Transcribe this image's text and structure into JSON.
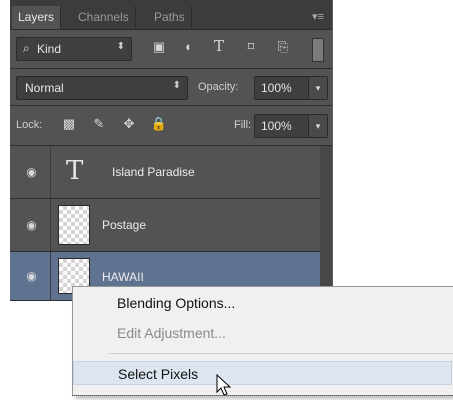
{
  "tabs": [
    {
      "label": "Layers",
      "active": true
    },
    {
      "label": "Channels",
      "active": false
    },
    {
      "label": "Paths",
      "active": false
    }
  ],
  "panel_menu_icon": "panel-menu-icon",
  "filter": {
    "label": "Kind",
    "icons": [
      "image-filter-icon",
      "adjustment-filter-icon",
      "type-filter-icon",
      "shape-filter-icon",
      "smart-object-filter-icon"
    ]
  },
  "blend_mode": "Normal",
  "opacity": {
    "label": "Opacity:",
    "value": "100%"
  },
  "lock": {
    "label": "Lock:",
    "icons": [
      "lock-transparent-icon",
      "lock-image-icon",
      "lock-position-icon",
      "lock-all-icon"
    ]
  },
  "fill": {
    "label": "Fill:",
    "value": "100%"
  },
  "layers": [
    {
      "name": "Island Paradise",
      "type": "text",
      "selected": false
    },
    {
      "name": "Postage",
      "type": "image",
      "selected": false
    },
    {
      "name": "HAWAII",
      "type": "image",
      "selected": true
    }
  ],
  "context_menu": [
    {
      "label": "Blending Options...",
      "disabled": false,
      "hover": false
    },
    {
      "label": "Edit Adjustment...",
      "disabled": true,
      "hover": false
    },
    {
      "label": "Select Pixels",
      "disabled": false,
      "hover": true
    }
  ],
  "colors": {
    "panel_bg": "#535353",
    "selected_layer": "#5f7391",
    "menu_bg": "#f0f0f0",
    "menu_hover": "#dde6f0"
  }
}
